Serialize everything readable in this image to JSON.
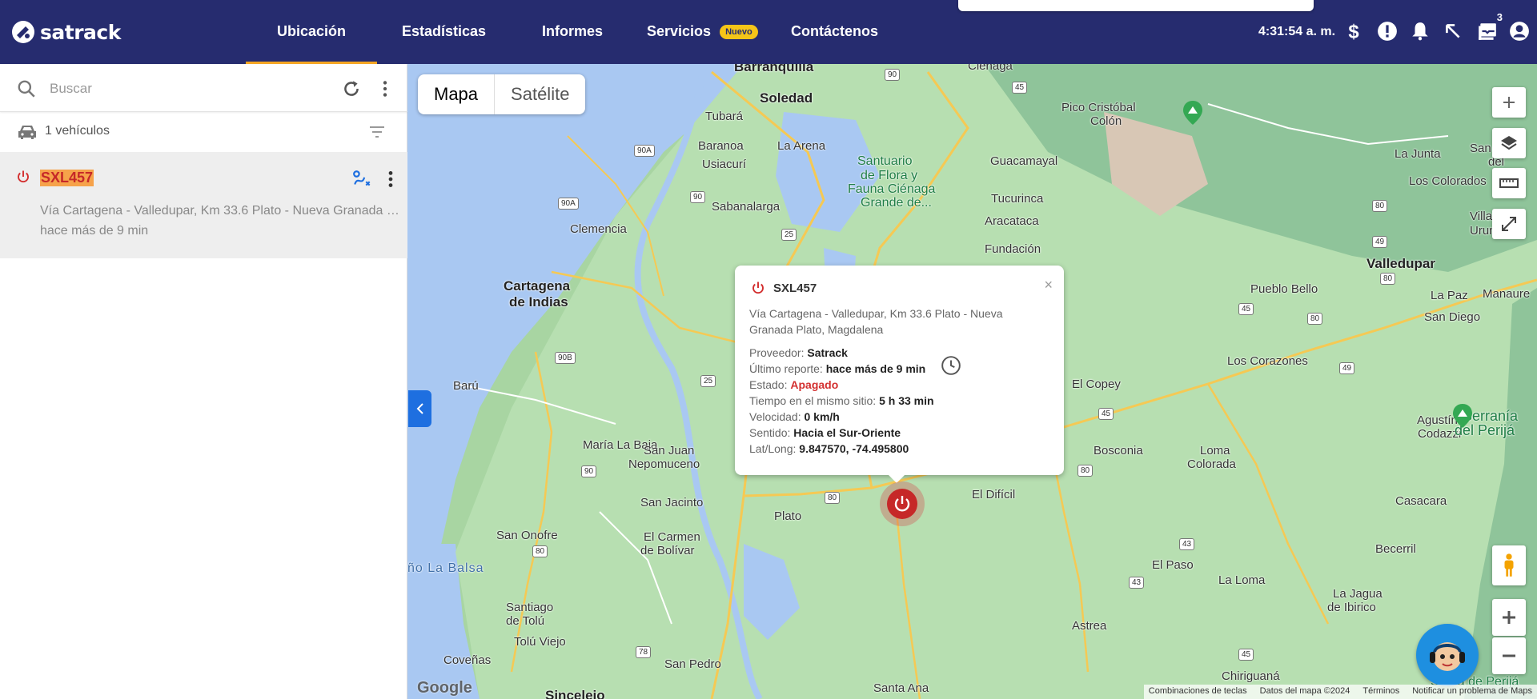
{
  "app": {
    "brand": "satrack"
  },
  "nav": {
    "items": [
      {
        "label": "Ubicación"
      },
      {
        "label": "Estadísticas"
      },
      {
        "label": "Informes"
      },
      {
        "label": "Servicios"
      },
      {
        "label": "Contáctenos"
      }
    ],
    "new_badge": "Nuevo"
  },
  "header": {
    "clock": "4:31:54 a. m.",
    "notification_count": "3"
  },
  "sidebar": {
    "search_placeholder": "Buscar",
    "vehicle_count": "1 vehículos",
    "vehicles": [
      {
        "plate": "SXL457",
        "address": "Vía Cartagena - Valledupar, Km 33.6 Plato - Nueva Granada Plato, Magdalena",
        "time": "hace más de 9 min"
      }
    ]
  },
  "map": {
    "type_buttons": [
      "Mapa",
      "Satélite"
    ],
    "labels": {
      "barranquilla": "Barranquilla",
      "soledad": "Soledad",
      "tubara": "Tubará",
      "baranoa": "Baranoa",
      "la_arena": "La Arena",
      "usiacuri": "Usiacurí",
      "sabanalarga": "Sabanalarga",
      "clemencia": "Clemencia",
      "cartagena_1": "Cartagena",
      "cartagena_2": "de Indias",
      "baru": "Barú",
      "maria_la_baja": "María La Baja",
      "san_juan_1": "San Juan",
      "san_juan_2": "Nepomuceno",
      "san_jacinto": "San Jacinto",
      "san_onofre": "San Onofre",
      "el_carmen_1": "El Carmen",
      "el_carmen_2": "de Bolívar",
      "santiago_1": "Santiago",
      "santiago_2": "de Tolú",
      "tolu_viejo": "Tolú Viejo",
      "covenas": "Coveñas",
      "san_pedro": "San Pedro",
      "sincelejo": "Sincelejo",
      "santa_ana": "Santa Ana",
      "plato": "Plato",
      "el_dificil": "El Difícil",
      "cienaga": "Ciénaga",
      "guacamayal": "Guacamayal",
      "tucurinca": "Tucurinca",
      "aracataca": "Aracataca",
      "fundacion": "Fundación",
      "santuario_1": "Santuario",
      "santuario_2": "de Flora y",
      "santuario_3": "Fauna Ciénaga",
      "santuario_4": "Grande de...",
      "pico_1": "Pico Cristóbal",
      "pico_2": "Colón",
      "la_junta": "La Junta",
      "san_juan_del_1": "San Juan",
      "san_juan_del_2": "del",
      "los_colorados": "Los Colorados",
      "villanueva": "Villanueva",
      "urumita": "Urumita",
      "valledupar": "Valledupar",
      "pueblo_bello": "Pueblo Bello",
      "la_paz": "La Paz",
      "manaure": "Manaure",
      "san_diego": "San Diego",
      "los_corazones": "Los Corazones",
      "el_copey": "El Copey",
      "agustin_1": "Agustín",
      "agustin_2": "Codazzi",
      "serrania_1": "Serranía",
      "serrania_2": "del Perijá",
      "bosconia": "Bosconia",
      "loma_1": "Loma",
      "loma_2": "Colorada",
      "casacara": "Casacara",
      "becerril": "Becerril",
      "el_paso": "El Paso",
      "la_loma": "La Loma",
      "la_jagua_1": "La Jagua",
      "la_jagua_2": "de Ibirico",
      "astrea": "Astrea",
      "chiriguana": "Chiriguaná",
      "sierra": "Sierra de Perijá",
      "balsa": "ño La Balsa"
    },
    "shields": [
      "90",
      "45",
      "90A",
      "90",
      "90A",
      "25",
      "90B",
      "25",
      "90",
      "80",
      "80",
      "78",
      "45",
      "80",
      "49",
      "80",
      "80",
      "49",
      "45",
      "80",
      "43",
      "43",
      "45"
    ],
    "attribution": [
      "Combinaciones de teclas",
      "Datos del mapa ©2024",
      "Términos",
      "Notificar un problema de Maps"
    ],
    "google": "Google"
  },
  "popup": {
    "plate": "SXL457",
    "address_line1": "Vía Cartagena - Valledupar, Km 33.6 Plato - Nueva",
    "address_line2": "Granada Plato, Magdalena",
    "provider_label": "Proveedor:",
    "provider": "Satrack",
    "last_report_label": "Último reporte:",
    "last_report": "hace más de 9 min",
    "state_label": "Estado:",
    "state": "Apagado",
    "time_label": "Tiempo en el mismo sitio:",
    "time": "5 h 33 min",
    "speed_label": "Velocidad:",
    "speed": "0 km/h",
    "direction_label": "Sentido:",
    "direction": "Hacia el Sur-Oriente",
    "latlong_label": "Lat/Long:",
    "latlong": "9.847570, -74.495800",
    "close": "×"
  },
  "colors": {
    "nav_bg": "#262c6f",
    "accent": "#f5a623",
    "off_red": "#c62828",
    "collapse_blue": "#1e6fe0"
  }
}
